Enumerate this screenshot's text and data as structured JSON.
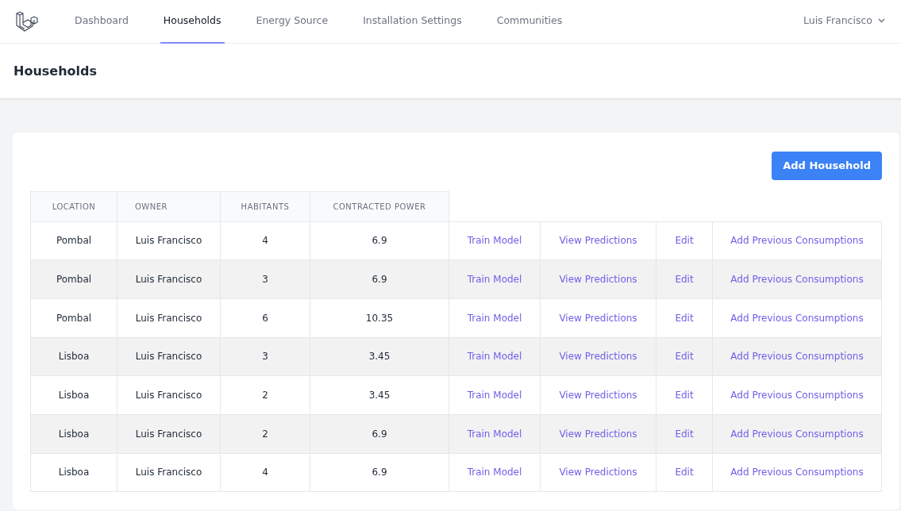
{
  "nav": {
    "links": [
      {
        "label": "Dashboard",
        "selected": false
      },
      {
        "label": "Households",
        "selected": true
      },
      {
        "label": "Energy Source",
        "selected": false
      },
      {
        "label": "Installation Settings",
        "selected": false
      },
      {
        "label": "Communities",
        "selected": false
      }
    ],
    "user": "Luis Francisco"
  },
  "page_title": "Households",
  "add_button": "Add Household",
  "table": {
    "columns": [
      "LOCATION",
      "OWNER",
      "HABITANTS",
      "CONTRACTED POWER"
    ],
    "rows": [
      {
        "cells": [
          "Pombal",
          "Luis Francisco",
          "4",
          "6.9"
        ],
        "actions": [
          "Train Model",
          "View Predictions",
          "Edit",
          "Add Previous Consumptions"
        ]
      },
      {
        "cells": [
          "Pombal",
          "Luis Francisco",
          "3",
          "6.9"
        ],
        "actions": [
          "Train Model",
          "View Predictions",
          "Edit",
          "Add Previous Consumptions"
        ]
      },
      {
        "cells": [
          "Pombal",
          "Luis Francisco",
          "6",
          "10.35"
        ],
        "actions": [
          "Train Model",
          "View Predictions",
          "Edit",
          "Add Previous Consumptions"
        ]
      },
      {
        "cells": [
          "Lisboa",
          "Luis Francisco",
          "3",
          "3.45"
        ],
        "actions": [
          "Train Model",
          "View Predictions",
          "Edit",
          "Add Previous Consumptions"
        ]
      },
      {
        "cells": [
          "Lisboa",
          "Luis Francisco",
          "2",
          "3.45"
        ],
        "actions": [
          "Train Model",
          "View Predictions",
          "Edit",
          "Add Previous Consumptions"
        ]
      },
      {
        "cells": [
          "Lisboa",
          "Luis Francisco",
          "2",
          "6.9"
        ],
        "actions": [
          "Train Model",
          "View Predictions",
          "Edit",
          "Add Previous Consumptions"
        ]
      },
      {
        "cells": [
          "Lisboa",
          "Luis Francisco",
          "4",
          "6.9"
        ],
        "actions": [
          "Train Model",
          "View Predictions",
          "Edit",
          "Add Previous Consumptions"
        ]
      }
    ]
  }
}
